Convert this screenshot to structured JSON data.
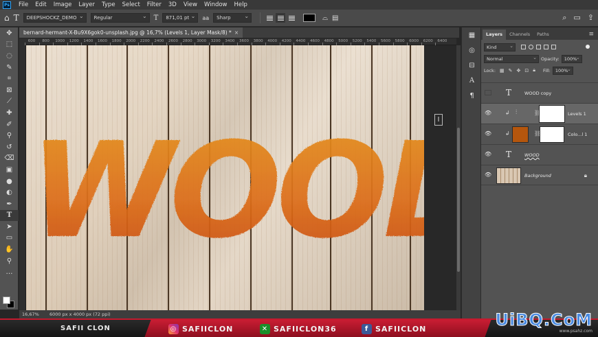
{
  "menubar": {
    "logo": "Ps",
    "items": [
      "File",
      "Edit",
      "Image",
      "Layer",
      "Type",
      "Select",
      "Filter",
      "3D",
      "View",
      "Window",
      "Help"
    ]
  },
  "options": {
    "font_family": "DEEPSHOCKZ_DEMO",
    "font_style": "Regular",
    "font_size": "871,01 pt",
    "antialias_label": "aa",
    "antialias": "Sharp",
    "text_color": "#000000"
  },
  "document": {
    "tab_title": "bernard-hermant-X-Bu9X6gok0-unsplash.jpg @ 16,7% (Levels 1, Layer Mask/8) *",
    "close": "×",
    "ruler_ticks": [
      "600",
      "800",
      "1000",
      "1200",
      "1400",
      "1600",
      "1800",
      "2000",
      "2200",
      "2400",
      "2600",
      "2800",
      "3000",
      "3200",
      "3400",
      "3600",
      "3800",
      "4000",
      "4200",
      "4400",
      "4600",
      "4800",
      "5000",
      "5200",
      "5400",
      "5600",
      "5800",
      "6000",
      "6200",
      "6400"
    ],
    "artwork_text": "WOOD",
    "zoom": "16,67%",
    "doc_info": "6000 px x 4000 px (72 ppi)"
  },
  "panel": {
    "tabs": [
      "Layers",
      "Channels",
      "Paths"
    ],
    "filter_kind": "Kind",
    "blend_mode": "Normal",
    "opacity_label": "Opacity:",
    "opacity": "100%",
    "lock_label": "Lock:",
    "fill_label": "Fill:",
    "fill": "100%",
    "layers": [
      {
        "name": "WOOD copy",
        "visible": false
      },
      {
        "name": "Levels 1",
        "visible": true,
        "selected": true
      },
      {
        "name": "Colo...l 1",
        "visible": true,
        "swatch": "#b5560d"
      },
      {
        "name": "WOOD",
        "visible": true
      },
      {
        "name": "Background",
        "visible": true
      }
    ]
  },
  "banner": {
    "name": "SAFII CLON",
    "instagram": "SAFIICLON",
    "xbox": "SAFIICLON36",
    "facebook": "SAFIICLON",
    "watermark": "UiBQ.CoM",
    "watermark_sub": "www.psahz.com"
  },
  "colors": {
    "accent_red": "#c41a2e",
    "wood_text_orange": "#e0781a",
    "ps_blue": "#31a8ff"
  }
}
